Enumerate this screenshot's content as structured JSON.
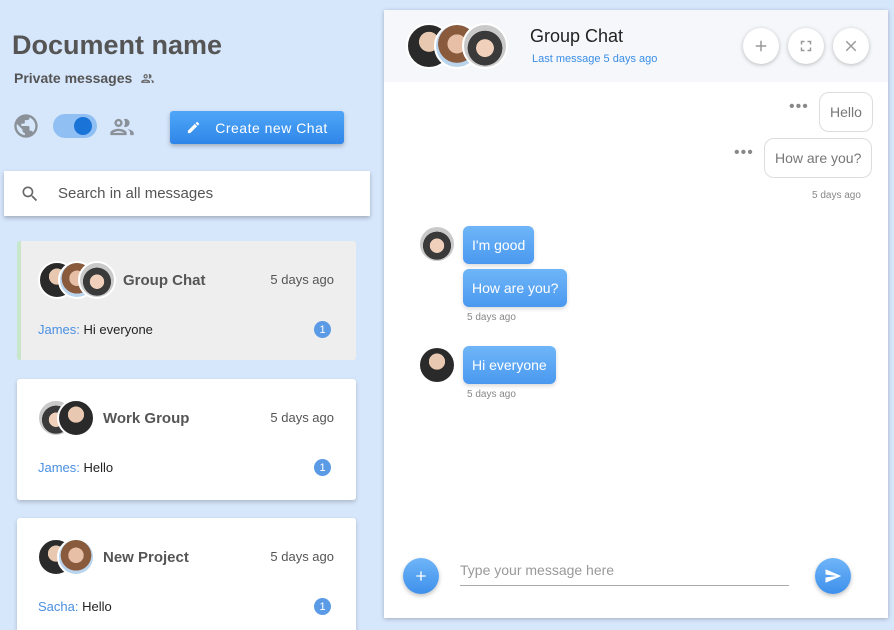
{
  "document": {
    "title": "Document name",
    "subtitle": "Private messages"
  },
  "controls": {
    "create_label": "Create new Chat",
    "toggle_on": true
  },
  "search": {
    "placeholder": "Search in all messages"
  },
  "chat_list": [
    {
      "name": "Group Chat",
      "time": "5 days ago",
      "sender": "James:",
      "preview": "Hi everyone",
      "unread": "1",
      "active": true
    },
    {
      "name": "Work Group",
      "time": "5 days ago",
      "sender": "James:",
      "preview": "Hello",
      "unread": "1",
      "active": false
    },
    {
      "name": "New Project",
      "time": "5 days ago",
      "sender": "Sacha:",
      "preview": "Hello",
      "unread": "1",
      "active": false
    }
  ],
  "chat": {
    "title": "Group Chat",
    "subtitle": "Last message 5 days ago",
    "messages": {
      "out1": "Hello",
      "out2": "How are you?",
      "out_time": "5 days ago",
      "in1": "I'm good",
      "in2": "How are you?",
      "in_time1": "5 days ago",
      "in3": "Hi everyone",
      "in_time2": "5 days ago"
    },
    "composer_placeholder": "Type your message here"
  },
  "colors": {
    "background": "#d6e6fb",
    "accent": "#3a8ee6",
    "badge": "#5b9be6",
    "active_card_border": "#c8e6c9"
  }
}
